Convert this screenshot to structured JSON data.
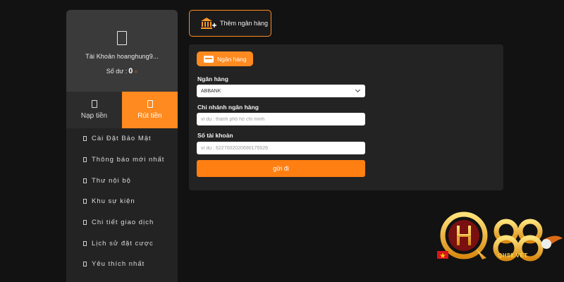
{
  "account": {
    "name": "Tài Khoản hoanghung9...",
    "balance_label": "Số dư :",
    "balance_value": "0",
    "refresh_glyph": "○"
  },
  "tabs": [
    {
      "label": "Nạp tiền",
      "active": false
    },
    {
      "label": "Rút tiền",
      "active": true
    }
  ],
  "menu": [
    {
      "label": "Cài Đặt Bảo Mật"
    },
    {
      "label": "Thông báo mới nhất"
    },
    {
      "label": "Thư nội bộ"
    },
    {
      "label": "Khu sự kiện"
    },
    {
      "label": "Chi tiết giao dịch"
    },
    {
      "label": "Lịch sử đặt cược"
    },
    {
      "label": "Yêu thích nhất"
    }
  ],
  "add_bank": {
    "label": "Thêm ngân hàng",
    "icon": "bank-plus-icon"
  },
  "form": {
    "section_label": "Ngân hàng",
    "bank_label": "Ngân hàng",
    "bank_selected": "ABBANK",
    "branch_label": "Chi nhánh ngân hàng",
    "branch_placeholder": "ví dụ : thành phố hồ chí minh",
    "account_label": "Số tài khoản",
    "account_placeholder": "ví dụ : 6227002020690175526",
    "submit_label": "gửi đi"
  },
  "logo": {
    "text": "QH88.VET",
    "mark": "QH88"
  },
  "colors": {
    "accent": "#ff8a1f",
    "background": "#121212",
    "panel": "#232323"
  }
}
